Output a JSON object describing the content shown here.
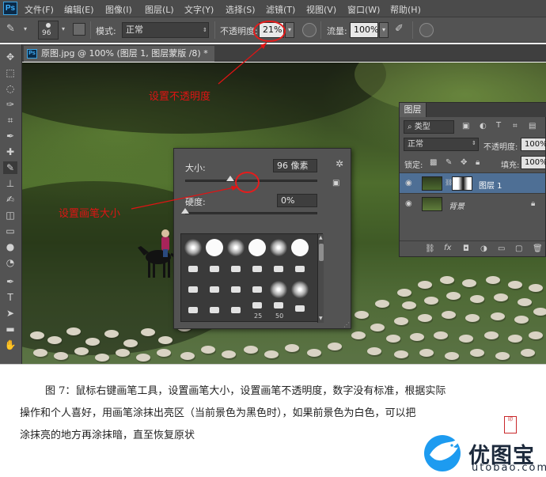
{
  "menu": [
    "文件(F)",
    "编辑(E)",
    "图像(I)",
    "图层(L)",
    "文字(Y)",
    "选择(S)",
    "滤镜(T)",
    "视图(V)",
    "窗口(W)",
    "帮助(H)"
  ],
  "options": {
    "brush_size": "96",
    "mode_label": "模式:",
    "mode_value": "正常",
    "opacity_label": "不透明度:",
    "opacity_value": "21%",
    "flow_label": "流量:",
    "flow_value": "100%"
  },
  "document_tab": "原图.jpg @ 100% (图层 1, 图层蒙版 /8) *",
  "annotations": {
    "opacity_note": "设置不透明度",
    "size_note": "设置画笔大小"
  },
  "brush_popup": {
    "size_label": "大小:",
    "size_value": "96 像素",
    "size_fraction": 0.34,
    "hardness_label": "硬度:",
    "hardness_value": "0%",
    "hardness_fraction": 0.0,
    "tip_numbers": [
      "25",
      "50"
    ]
  },
  "layers_panel": {
    "tab": "图层",
    "filter_label": "类型",
    "blend_mode": "正常",
    "opacity_label": "不透明度:",
    "opacity_value": "100%",
    "lock_label": "锁定:",
    "fill_label": "填充:",
    "fill_value": "100%",
    "layers": [
      {
        "name": "图层 1",
        "selected": true
      },
      {
        "name": "背景",
        "selected": false
      }
    ]
  },
  "caption": {
    "line1": "图 7：鼠标右键画笔工具，设置画笔大小，设置画笔不透明度，数字没有标准，根据实际",
    "line2": "操作和个人喜好，用画笔涂抹出亮区（当前景色为黑色时），如果前景色为白色，可以把",
    "line3": "涂抹亮的地方再涂抹暗，直至恢复原状"
  },
  "watermark": {
    "name": "优图宝",
    "url": "utobao.com",
    "seal": "印"
  },
  "colors": {
    "annotation": "#e01414",
    "ui_dark": "#535353",
    "brand": "#1d9bf0"
  }
}
